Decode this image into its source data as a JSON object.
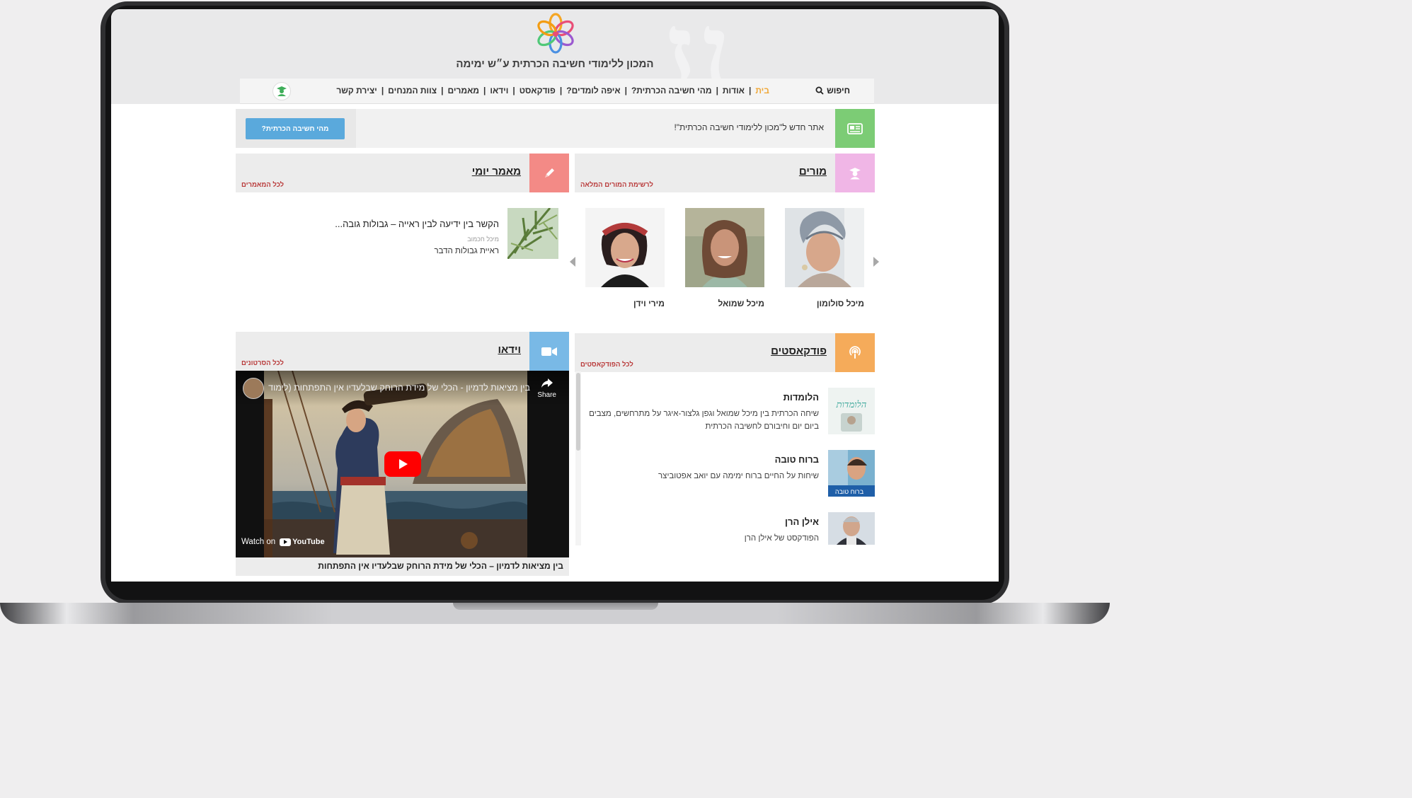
{
  "site": {
    "title": "המכון ללימודי חשיבה הכרתית ע״ש ימימה"
  },
  "nav": {
    "search_label": "חיפוש",
    "items": [
      {
        "label": "בית",
        "active": true
      },
      {
        "label": "אודות"
      },
      {
        "label": "מהי חשיבה הכרתית?"
      },
      {
        "label": "איפה לומדים?"
      },
      {
        "label": "פודקאסט"
      },
      {
        "label": "וידאו"
      },
      {
        "label": "מאמרים"
      },
      {
        "label": "צוות המנחים"
      },
      {
        "label": "יצירת קשר"
      }
    ]
  },
  "news": {
    "text": "אתר חדש ל\"מכון ללימודי חשיבה הכרתית\"!",
    "button_label": "מהי חשיבה הכרתית?"
  },
  "teachers": {
    "title": "מורים",
    "link": "לרשימת המורים המלאה",
    "items": [
      {
        "name": "מיכל סולומון"
      },
      {
        "name": "מיכל שמואל"
      },
      {
        "name": "מירי וידן"
      }
    ]
  },
  "daily_article": {
    "title": "מאמר יומי",
    "link": "לכל המאמרים",
    "article_title": "הקשר בין ידיעה לבין ראייה – גבולות גובה...",
    "author": "מיכל חכמוב",
    "category": "ראיית גבולות הדבר"
  },
  "podcasts": {
    "title": "פודקאסטים",
    "link": "לכל הפודקאסטים",
    "items": [
      {
        "title": "הלומדות",
        "desc": "שיחה הכרתית בין מיכל שמואל וגפן גלצור-איגר על מתרחשים, מצבים ביום יום וחיבורם לחשיבה הכרתית",
        "thumb_label": "הלומדות"
      },
      {
        "title": "ברוח טובה",
        "desc": "שיחות על החיים ברוח ימימה עם יואב אפטוביצר",
        "thumb_label": "ברוח טובה"
      },
      {
        "title": "אילן הרן",
        "desc": "הפודקסט של אילן הרן"
      }
    ]
  },
  "video": {
    "title": "וידאו",
    "link": "לכל הסרטונים",
    "player_title": "בין מציאות לדמיון - הכלי של מידת הרוחק שבלעדיו אין התפתחות (לימודי ימימה)",
    "share_label": "Share",
    "watch_on": "Watch on",
    "youtube": "YouTube",
    "caption": "בין מציאות לדמיון – הכלי של מידת הרוחק שבלעדיו אין התפתחות"
  },
  "colors": {
    "news_green": "#7ccc75",
    "teachers_pink": "#f0b6e6",
    "article_red": "#f38a86",
    "podcast_orange": "#f5ab5a",
    "video_blue": "#79b9e6",
    "link_red": "#b93a3a",
    "button_blue": "#5aa9dc",
    "nav_active": "#f0a93a"
  }
}
